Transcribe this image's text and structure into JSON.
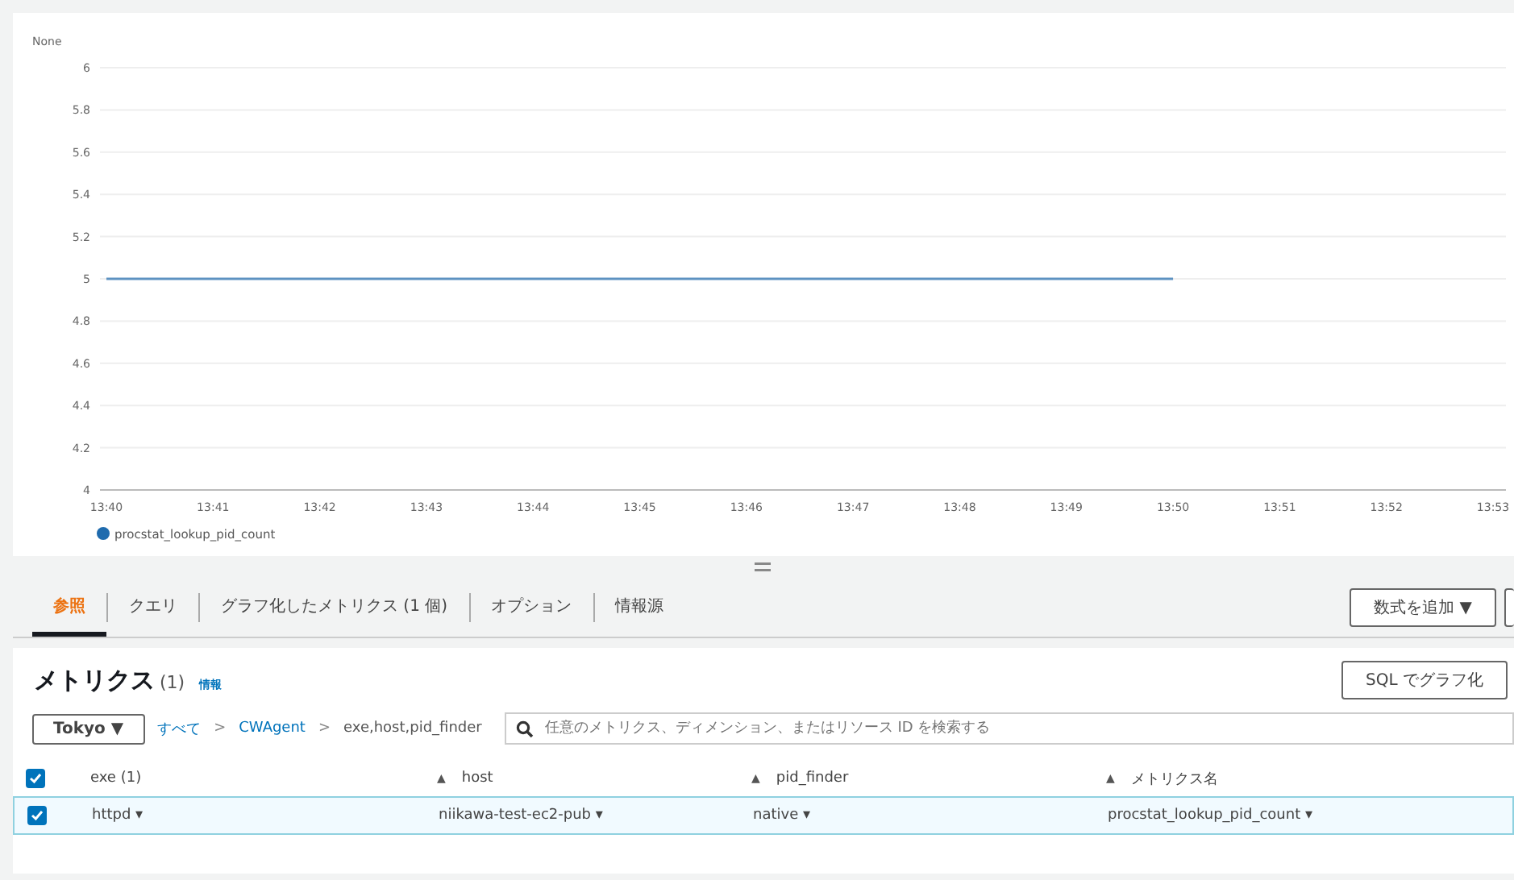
{
  "graph": {
    "chart_data": {
      "type": "line",
      "grid": true,
      "ylabel": "None",
      "categories": [
        "13:40",
        "13:41",
        "13:42",
        "13:43",
        "13:44",
        "13:45",
        "13:46",
        "13:47",
        "13:48",
        "13:49",
        "13:50",
        "13:51",
        "13:52",
        "13:53"
      ],
      "ylim": [
        4,
        6
      ],
      "yticks": [
        4,
        4.2,
        4.4,
        4.6,
        4.8,
        5,
        5.2,
        5.4,
        5.6,
        5.8,
        6
      ],
      "series": [
        {
          "name": "procstat_lookup_pid_count",
          "color": "#1f6bae",
          "values": [
            5,
            5,
            5,
            5,
            5,
            5,
            5,
            5,
            5,
            5,
            5,
            null,
            null,
            null
          ]
        }
      ]
    }
  },
  "tabs": [
    {
      "label": "参照",
      "selected": true
    },
    {
      "label": "クエリ",
      "selected": false
    },
    {
      "label": "グラフ化したメトリクス (1 個)",
      "selected": false
    },
    {
      "label": "オプション",
      "selected": false
    },
    {
      "label": "情報源",
      "selected": false
    }
  ],
  "add_math_button": {
    "label": "数式を追加 ▼"
  },
  "metrics": {
    "title": "メトリクス",
    "count": "(1)",
    "info_link": "情報",
    "sql_button": "SQL でグラフ化",
    "region": "Tokyo ▼",
    "breadcrumbs": [
      "すべて",
      "CWAgent",
      "exe,host,pid_finder"
    ],
    "separator": ">",
    "search": {
      "placeholder": "任意のメトリクス、ディメンション、またはリソース ID を検索する"
    },
    "table": {
      "header_checked": true,
      "columns": [
        "exe (1)",
        "host",
        "pid_finder",
        "メトリクス名"
      ],
      "sort_mark": "▲",
      "rows": [
        {
          "selected": true,
          "cells": [
            "httpd ▾",
            "niikawa-test-ec2-pub ▾",
            "native ▾",
            "procstat_lookup_pid_count ▾"
          ]
        }
      ]
    }
  }
}
